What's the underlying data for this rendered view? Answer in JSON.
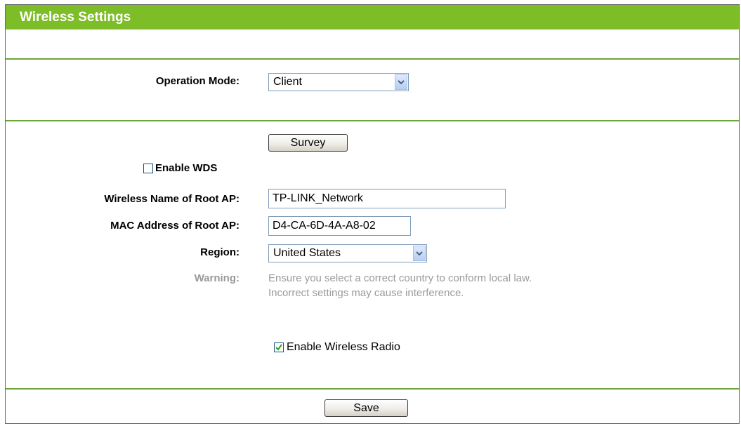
{
  "header": {
    "title": "Wireless Settings"
  },
  "operation_mode": {
    "label": "Operation Mode:",
    "value": "Client"
  },
  "survey": {
    "label": "Survey"
  },
  "wds": {
    "label": "Enable WDS",
    "checked": false
  },
  "root_ap_name": {
    "label": "Wireless Name of Root AP:",
    "value": "TP-LINK_Network"
  },
  "root_ap_mac": {
    "label": "MAC Address of Root AP:",
    "value": "D4-CA-6D-4A-A8-02"
  },
  "region": {
    "label": "Region:",
    "value": "United States"
  },
  "warning": {
    "label": "Warning:",
    "line1": "Ensure you select a correct country to conform local law.",
    "line2": "Incorrect settings may cause interference."
  },
  "wireless_radio": {
    "label": "Enable Wireless Radio",
    "checked": true
  },
  "save": {
    "label": "Save"
  },
  "colors": {
    "accent": "#7dbd27",
    "rule": "#6aa43a",
    "warning_text": "#999999"
  }
}
